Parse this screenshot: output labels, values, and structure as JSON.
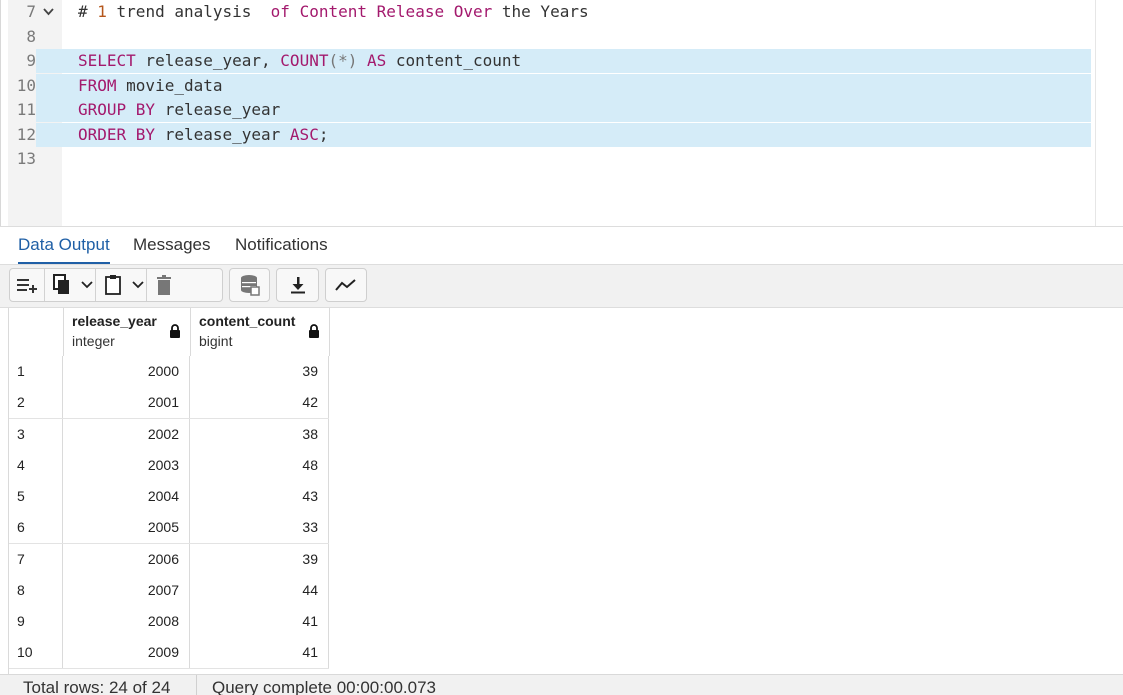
{
  "editor": {
    "lines": [
      {
        "num": "7",
        "fold": true,
        "selected": false,
        "tokens": [
          {
            "t": "# ",
            "k": "id"
          },
          {
            "t": "1",
            "k": "num"
          },
          {
            "t": " trend analysis  ",
            "k": "id"
          },
          {
            "t": "of",
            "k": "kw"
          },
          {
            "t": " ",
            "k": "id"
          },
          {
            "t": "Content",
            "k": "kw"
          },
          {
            "t": " ",
            "k": "id"
          },
          {
            "t": "Release",
            "k": "kw"
          },
          {
            "t": " ",
            "k": "id"
          },
          {
            "t": "Over",
            "k": "kw"
          },
          {
            "t": " the Years",
            "k": "id"
          }
        ]
      },
      {
        "num": "8",
        "fold": false,
        "selected": false,
        "tokens": []
      },
      {
        "num": "9",
        "fold": false,
        "selected": true,
        "tokens": [
          {
            "t": "SELECT",
            "k": "kw"
          },
          {
            "t": " release_year, ",
            "k": "id"
          },
          {
            "t": "COUNT",
            "k": "kw"
          },
          {
            "t": "(*)",
            "k": "op"
          },
          {
            "t": " ",
            "k": "id"
          },
          {
            "t": "AS",
            "k": "kw"
          },
          {
            "t": " content_count",
            "k": "id"
          }
        ]
      },
      {
        "num": "10",
        "fold": false,
        "selected": true,
        "tokens": [
          {
            "t": "FROM",
            "k": "kw"
          },
          {
            "t": " movie_data",
            "k": "id"
          }
        ]
      },
      {
        "num": "11",
        "fold": false,
        "selected": true,
        "tokens": [
          {
            "t": "GROUP BY",
            "k": "kw"
          },
          {
            "t": " release_year",
            "k": "id"
          }
        ]
      },
      {
        "num": "12",
        "fold": false,
        "selected": true,
        "tokens": [
          {
            "t": "ORDER BY",
            "k": "kw"
          },
          {
            "t": " release_year ",
            "k": "id"
          },
          {
            "t": "ASC",
            "k": "kw"
          },
          {
            "t": ";",
            "k": "id"
          }
        ]
      },
      {
        "num": "13",
        "fold": false,
        "selected": false,
        "tokens": []
      }
    ]
  },
  "tabs": {
    "data_output": "Data Output",
    "messages": "Messages",
    "notifications": "Notifications",
    "active": "data_output"
  },
  "toolbar": {
    "icons": [
      "add-row-icon",
      "copy-icon",
      "chevron-down-icon",
      "paste-icon",
      "chevron-down-icon",
      "delete-icon",
      "save-data-icon",
      "download-icon",
      "graph-visualiser-icon"
    ]
  },
  "grid": {
    "columns": [
      {
        "name": "release_year",
        "type": "integer"
      },
      {
        "name": "content_count",
        "type": "bigint"
      }
    ],
    "rows": [
      {
        "n": "1",
        "year": "2000",
        "count": "39"
      },
      {
        "n": "2",
        "year": "2001",
        "count": "42"
      },
      {
        "n": "3",
        "year": "2002",
        "count": "38"
      },
      {
        "n": "4",
        "year": "2003",
        "count": "48"
      },
      {
        "n": "5",
        "year": "2004",
        "count": "43"
      },
      {
        "n": "6",
        "year": "2005",
        "count": "33"
      },
      {
        "n": "7",
        "year": "2006",
        "count": "39"
      },
      {
        "n": "8",
        "year": "2007",
        "count": "44"
      },
      {
        "n": "9",
        "year": "2008",
        "count": "41"
      },
      {
        "n": "10",
        "year": "2009",
        "count": "41"
      }
    ]
  },
  "status": {
    "total_rows": "Total rows: 24 of 24",
    "query_complete": "Query complete 00:00:00.073"
  },
  "colors": {
    "keyword": "#a3196d",
    "number": "#b5561b",
    "selection": "#d5ecf8",
    "active_tab": "#1f5fa6"
  }
}
